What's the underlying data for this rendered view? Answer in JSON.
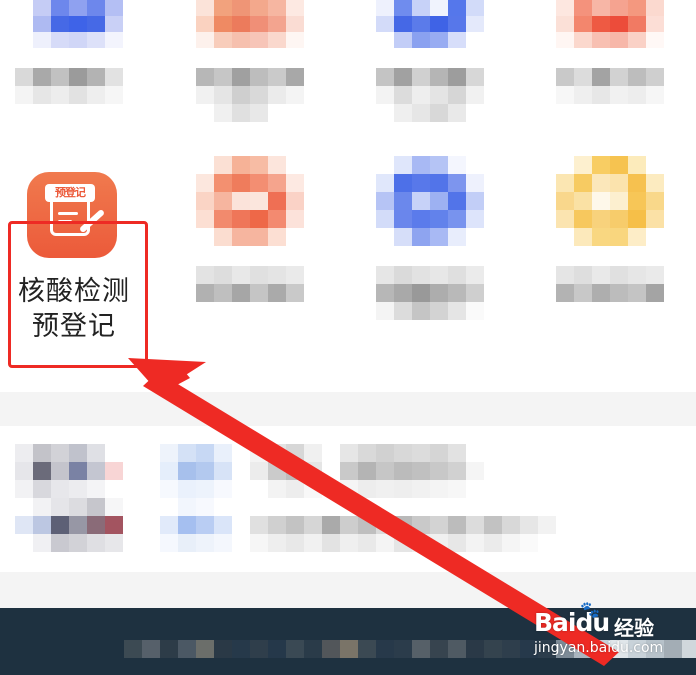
{
  "featured_app": {
    "icon_tag": "预登记",
    "label_line1": "核酸检测",
    "label_line2": "预登记",
    "icon_name": "pre-registration-icon"
  },
  "colors": {
    "highlight": "#ee2a24",
    "icon_orange": "#ec5a3a",
    "bottom_bar": "#1e3140"
  },
  "watermark": {
    "brand": "Baidu",
    "paw": "🐾",
    "cn": "经验",
    "domain": "jingyan.baidu.com"
  }
}
